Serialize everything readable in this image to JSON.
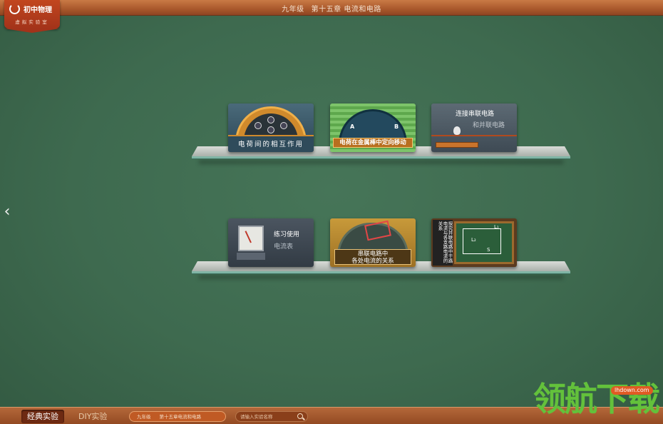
{
  "header": {
    "grade": "九年级",
    "chapter": "第十五章 电流和电路"
  },
  "logo": {
    "title": "初中物理",
    "subtitle": "虚拟实验室"
  },
  "nav": {
    "prev_icon": "chevron-left-icon"
  },
  "shelves": [
    {
      "cards": [
        {
          "label": "电荷间的相互作用"
        },
        {
          "label": "电荷在金属棒中定向移动",
          "mark_a": "A",
          "mark_b": "B"
        },
        {
          "line1": "连接串联电路",
          "line2": "和并联电路"
        }
      ]
    },
    {
      "cards": [
        {
          "line1": "练习使用",
          "line2": "电流表"
        },
        {
          "line1": "串联电路中",
          "line2": "各处电流的关系"
        },
        {
          "side_text": "探究并联电路中干路电流与各支路电流的关系",
          "l1": "L₁",
          "l2": "L₂",
          "s": "S"
        }
      ]
    }
  ],
  "bottom": {
    "tabs": [
      "经典实验",
      "DIY实验"
    ],
    "breadcrumb": [
      "九年级",
      "第十五章电流和电路"
    ],
    "search_placeholder": "请输入实验名称"
  },
  "watermark": {
    "badge": "lhdown.com",
    "text": "领航下载"
  },
  "colors": {
    "board": "#3f6b4f",
    "topbar": "#a9582c",
    "logo": "#b23c1c",
    "accent_orange": "#c05a24"
  }
}
